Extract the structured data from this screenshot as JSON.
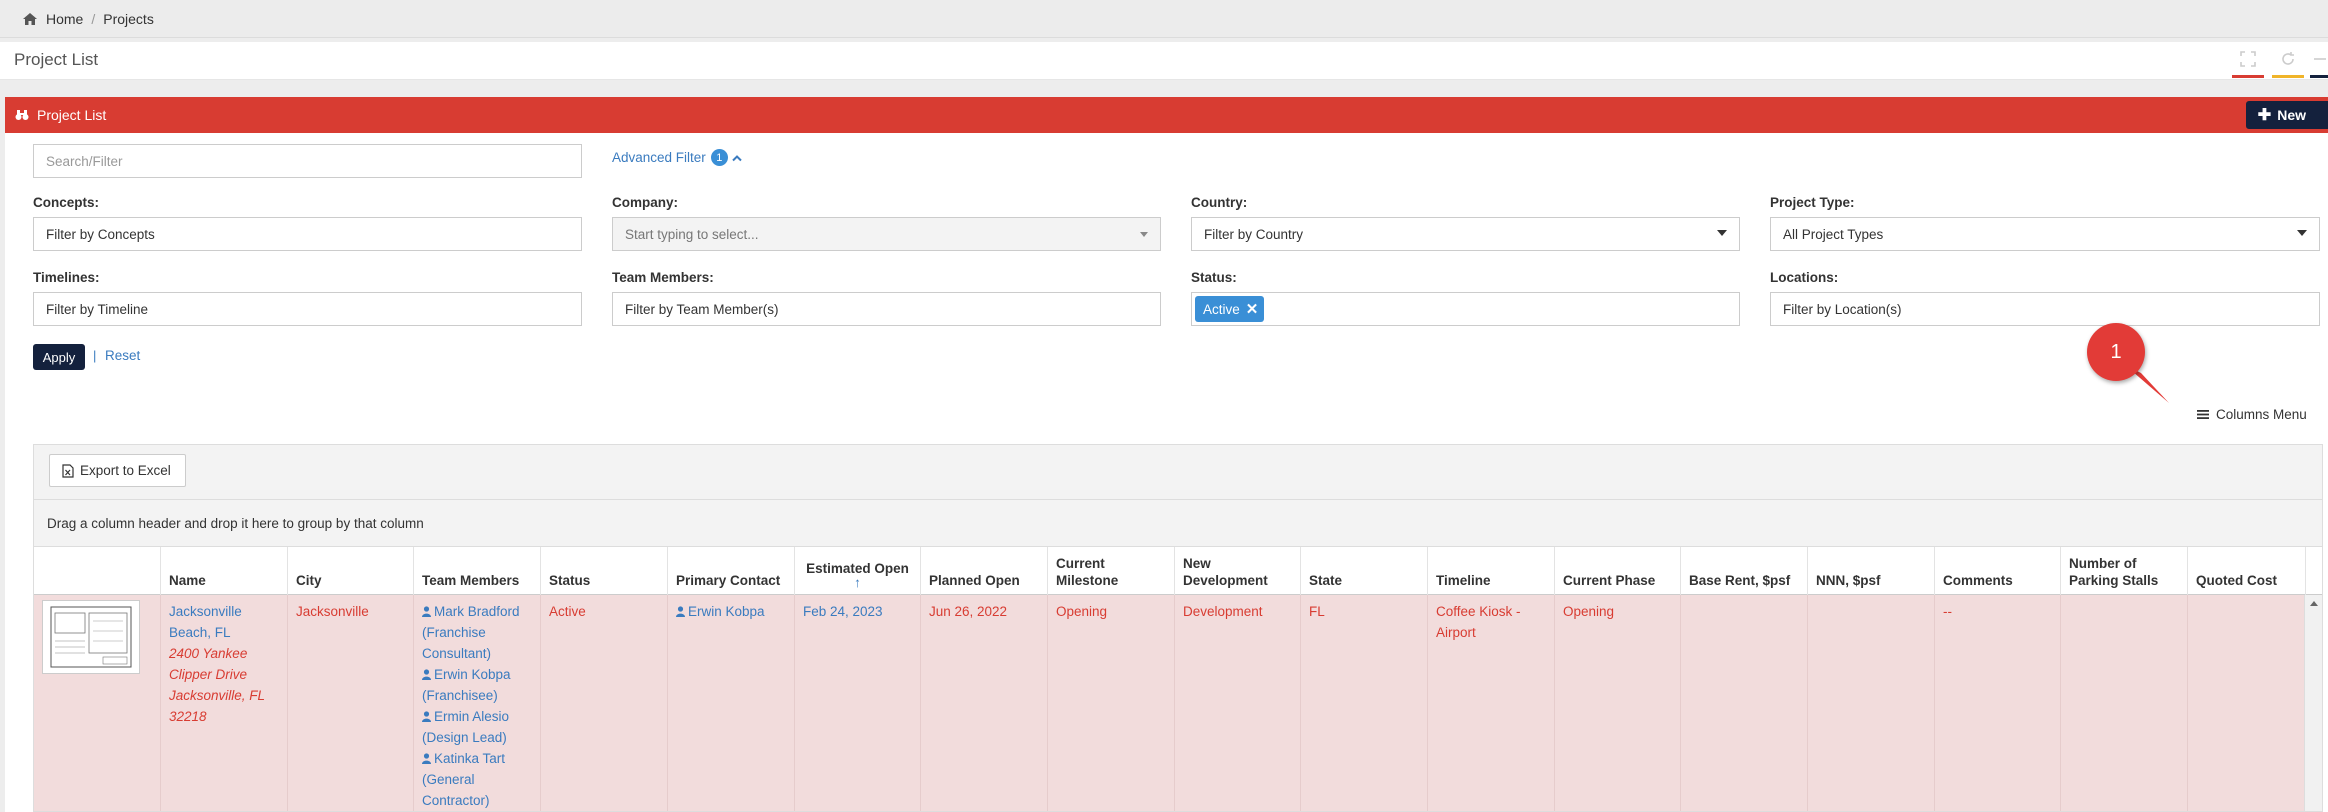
{
  "breadcrumb": {
    "home": "Home",
    "separator": "/",
    "current": "Projects"
  },
  "page_title": "Project List",
  "panel": {
    "title": "Project List",
    "new_button": "New"
  },
  "search": {
    "placeholder": "Search/Filter"
  },
  "advanced_filter": {
    "label": "Advanced Filter",
    "count": "1"
  },
  "filters": {
    "concepts": {
      "label": "Concepts:",
      "placeholder": "Filter by Concepts"
    },
    "company": {
      "label": "Company:",
      "placeholder": "Start typing to select..."
    },
    "country": {
      "label": "Country:",
      "value": "Filter by Country"
    },
    "project_type": {
      "label": "Project Type:",
      "value": "All Project Types"
    },
    "timelines": {
      "label": "Timelines:",
      "placeholder": "Filter by Timeline"
    },
    "team_members": {
      "label": "Team Members:",
      "placeholder": "Filter by Team Member(s)"
    },
    "status": {
      "label": "Status:",
      "chip": "Active"
    },
    "locations": {
      "label": "Locations:",
      "placeholder": "Filter by Location(s)"
    }
  },
  "actions": {
    "apply": "Apply",
    "separator": "|",
    "reset": "Reset"
  },
  "callout": {
    "number": "1"
  },
  "columns_menu": "Columns Menu",
  "grid": {
    "export_button": "Export to Excel",
    "group_hint": "Drag a column header and drop it here to group by that column",
    "columns": [
      {
        "l1": "",
        "l2": ""
      },
      {
        "l1": "",
        "l2": "Name"
      },
      {
        "l1": "",
        "l2": "City"
      },
      {
        "l1": "",
        "l2": "Team Members"
      },
      {
        "l1": "",
        "l2": "Status"
      },
      {
        "l1": "",
        "l2": "Primary Contact"
      },
      {
        "l1": "Estimated Open",
        "l2": "↑"
      },
      {
        "l1": "",
        "l2": "Planned Open"
      },
      {
        "l1": "Current",
        "l2": "Milestone"
      },
      {
        "l1": "New",
        "l2": "Development"
      },
      {
        "l1": "",
        "l2": "State"
      },
      {
        "l1": "",
        "l2": "Timeline"
      },
      {
        "l1": "",
        "l2": "Current Phase"
      },
      {
        "l1": "",
        "l2": "Base Rent, $psf"
      },
      {
        "l1": "",
        "l2": "NNN, $psf"
      },
      {
        "l1": "",
        "l2": "Comments"
      },
      {
        "l1": "Number of",
        "l2": "Parking Stalls"
      },
      {
        "l1": "",
        "l2": "Quoted Cost"
      }
    ],
    "row": {
      "name_l1": "Jacksonville",
      "name_l2": "Beach, FL",
      "addr_l1": "2400 Yankee",
      "addr_l2": "Clipper Drive",
      "addr_l3": "Jacksonville, FL",
      "addr_l4": "32218",
      "city": "Jacksonville",
      "team": [
        {
          "l1": "Mark Bradford",
          "l2": "(Franchise",
          "l3": "Consultant)"
        },
        {
          "l1": "Erwin Kobpa",
          "l2": "(Franchisee)"
        },
        {
          "l1": "Ermin Alesio",
          "l2": "(Design Lead)"
        },
        {
          "l1": "Katinka Tart",
          "l2": "(General",
          "l3": "Contractor)"
        }
      ],
      "status": "Active",
      "primary_contact": "Erwin Kobpa",
      "estimated_open": "Feb 24, 2023",
      "planned_open": "Jun 26, 2022",
      "current_milestone": "Opening",
      "new_development": "Development",
      "state": "FL",
      "timeline_l1": "Coffee Kiosk -",
      "timeline_l2": "Airport",
      "current_phase": "Opening",
      "base_rent": "",
      "nnn": "",
      "comments": "--",
      "parking": "",
      "quoted_cost": ""
    }
  },
  "colors": {
    "accent_red": "#d83c32",
    "navy": "#14213d",
    "link_blue": "#3a7bbf",
    "chip_blue": "#3a8fd6",
    "row_pink": "#f2dcdc"
  }
}
